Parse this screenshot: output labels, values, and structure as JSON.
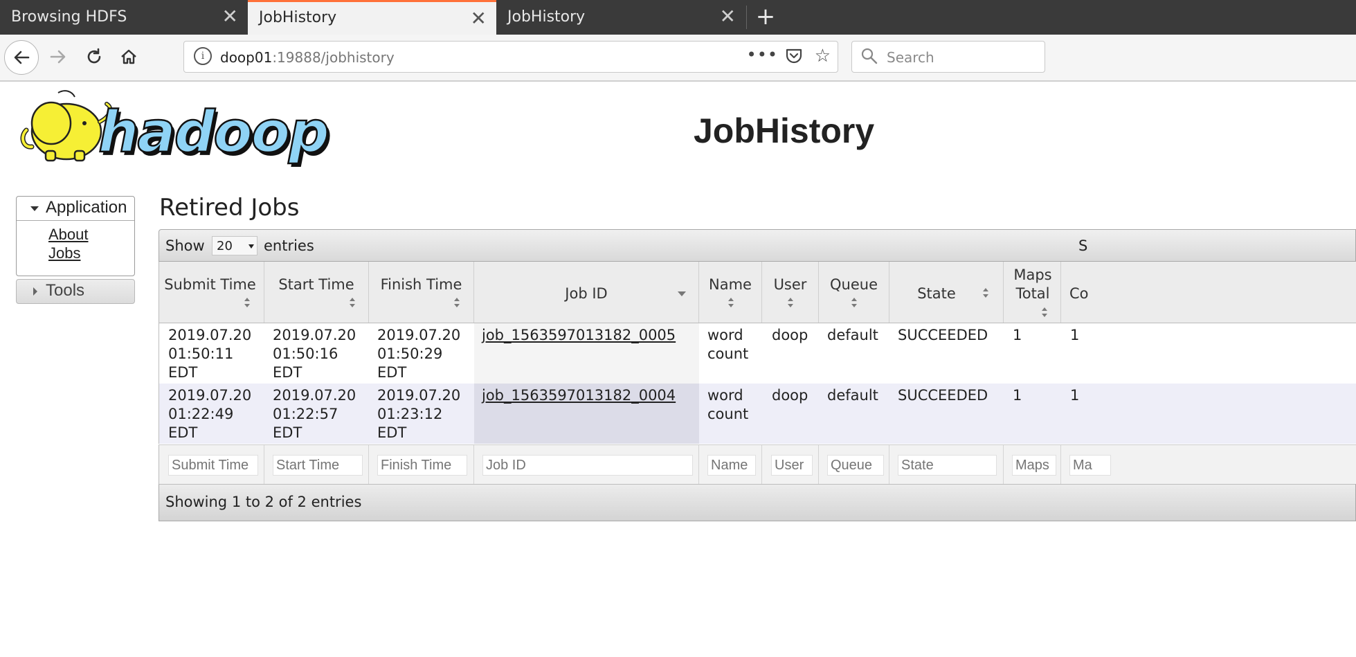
{
  "browser": {
    "tabs": [
      {
        "label": "Browsing HDFS",
        "active": false
      },
      {
        "label": "JobHistory",
        "active": true
      },
      {
        "label": "JobHistory",
        "active": false
      }
    ],
    "url_host": "doop01",
    "url_path": ":19888/jobhistory",
    "search_placeholder": "Search",
    "accent": "#ff7139"
  },
  "page": {
    "logo_alt": "hadoop",
    "title": "JobHistory"
  },
  "sidebar": {
    "application_label": "Application",
    "links": [
      "About",
      "Jobs"
    ],
    "tools_label": "Tools"
  },
  "main": {
    "section_title": "Retired Jobs",
    "show_label": "Show",
    "page_size": "20",
    "entries_label": "entries",
    "search_label_partial": "S",
    "columns": [
      "Submit Time",
      "Start Time",
      "Finish Time",
      "Job ID",
      "Name",
      "User",
      "Queue",
      "State",
      "Maps Total",
      "Co"
    ],
    "rows": [
      {
        "submit": [
          "2019.07.20",
          "01:50:11",
          "EDT"
        ],
        "start": [
          "2019.07.20",
          "01:50:16",
          "EDT"
        ],
        "finish": [
          "2019.07.20",
          "01:50:29",
          "EDT"
        ],
        "job_id": "job_1563597013182_0005",
        "name": [
          "word",
          "count"
        ],
        "user": "doop",
        "queue": "default",
        "state": "SUCCEEDED",
        "maps_total": "1",
        "co": "1"
      },
      {
        "submit": [
          "2019.07.20",
          "01:22:49",
          "EDT"
        ],
        "start": [
          "2019.07.20",
          "01:22:57",
          "EDT"
        ],
        "finish": [
          "2019.07.20",
          "01:23:12",
          "EDT"
        ],
        "job_id": "job_1563597013182_0004",
        "name": [
          "word",
          "count"
        ],
        "user": "doop",
        "queue": "default",
        "state": "SUCCEEDED",
        "maps_total": "1",
        "co": "1"
      }
    ],
    "filters": [
      "Submit Time",
      "Start Time",
      "Finish Time",
      "Job ID",
      "Name",
      "User",
      "Queue",
      "State",
      "Maps",
      "Ma"
    ],
    "footer_info": "Showing 1 to 2 of 2 entries"
  },
  "colors": {
    "row_even": "#eeeef8",
    "logo_yellow": "#f6ef35",
    "logo_blue": "#8fd3f5"
  }
}
